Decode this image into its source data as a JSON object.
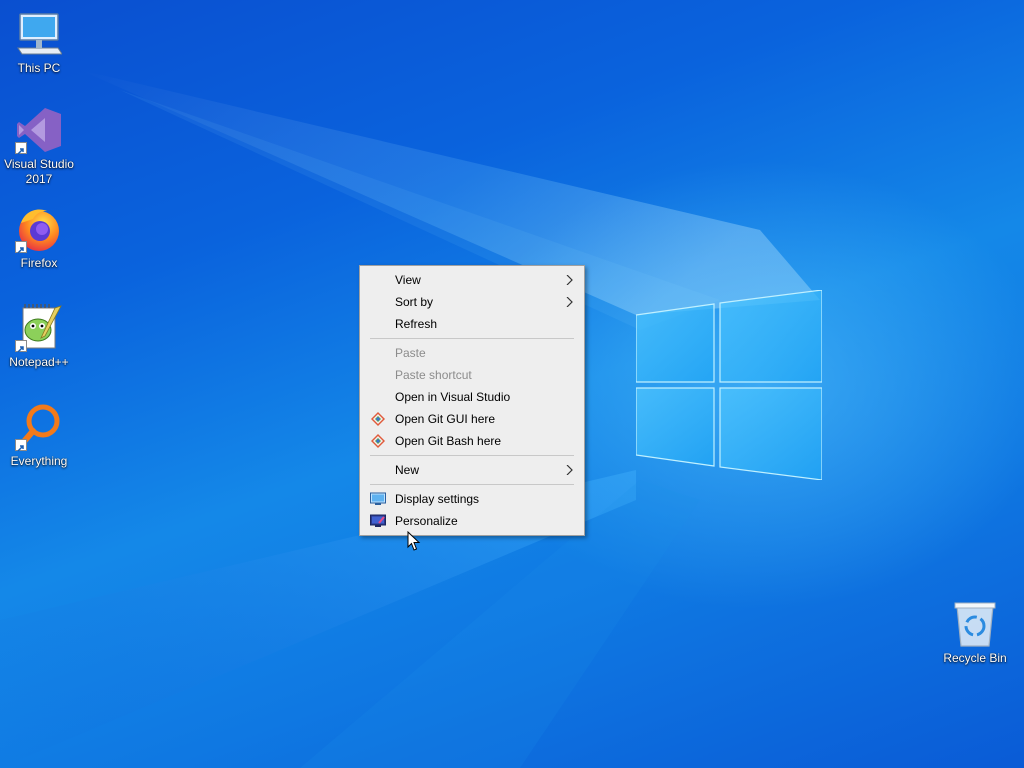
{
  "desktop_icons": [
    {
      "name": "this-pc",
      "label": "This PC",
      "shortcut": false
    },
    {
      "name": "visual-studio",
      "label": "Visual Studio 2017",
      "shortcut": true
    },
    {
      "name": "firefox",
      "label": "Firefox",
      "shortcut": true
    },
    {
      "name": "notepad-plus-plus",
      "label": "Notepad++",
      "shortcut": true
    },
    {
      "name": "everything",
      "label": "Everything",
      "shortcut": true
    },
    {
      "name": "recycle-bin",
      "label": "Recycle Bin",
      "shortcut": false
    }
  ],
  "context_menu": {
    "view": "View",
    "sort_by": "Sort by",
    "refresh": "Refresh",
    "paste": "Paste",
    "paste_shortcut": "Paste shortcut",
    "open_in_vs": "Open in Visual Studio",
    "open_git_gui": "Open Git GUI here",
    "open_git_bash": "Open Git Bash here",
    "new": "New",
    "display_settings": "Display settings",
    "personalize": "Personalize"
  },
  "colors": {
    "wallpaper_blue": "#0a63dd",
    "menu_bg": "#eeeeee",
    "disabled_text": "#8c8c8c"
  },
  "icons": {
    "this_pc": "monitor-icon",
    "visual_studio": "visual-studio-icon",
    "firefox": "firefox-icon",
    "notepad_plus_plus": "notepad-plus-plus-icon",
    "everything": "magnifier-icon",
    "recycle_bin": "recycle-bin-icon",
    "submenu": "chevron-right-icon",
    "git": "git-icon",
    "display": "display-icon",
    "personalize": "personalize-icon"
  }
}
